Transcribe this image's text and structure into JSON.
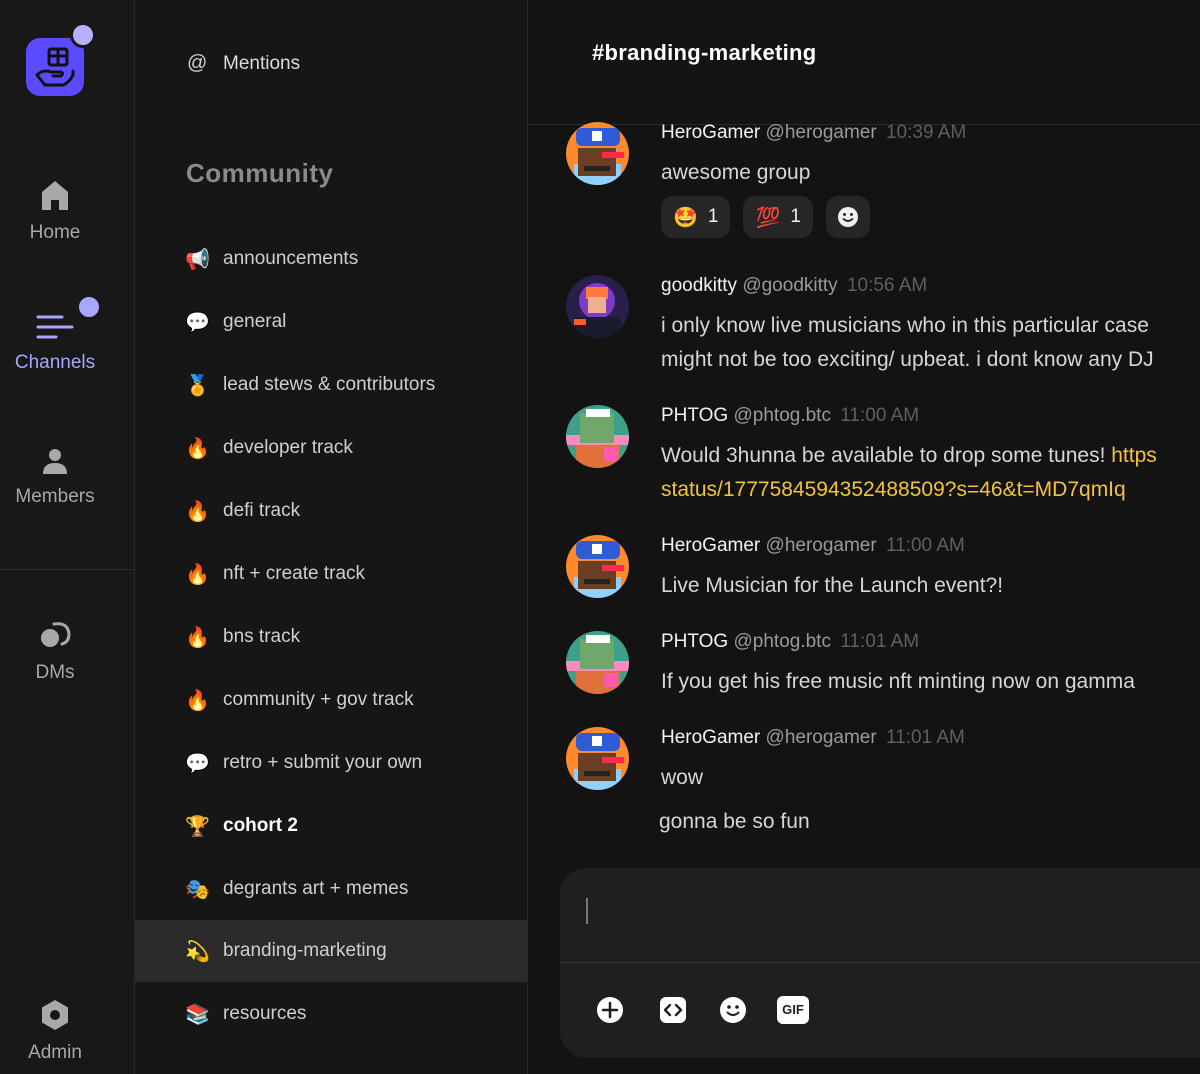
{
  "rail": {
    "home_label": "Home",
    "channels_label": "Channels",
    "members_label": "Members",
    "dms_label": "DMs",
    "admin_label": "Admin"
  },
  "sidebar": {
    "mentions_label": "Mentions",
    "section_title": "Community",
    "channels": [
      {
        "emoji": "📢",
        "name": "announcements"
      },
      {
        "emoji": "💬",
        "name": "general"
      },
      {
        "emoji": "🏅",
        "name": "lead stews & contributors"
      },
      {
        "emoji": "🔥",
        "name": "developer track"
      },
      {
        "emoji": "🔥",
        "name": "defi track"
      },
      {
        "emoji": "🔥",
        "name": "nft + create track"
      },
      {
        "emoji": "🔥",
        "name": "bns track"
      },
      {
        "emoji": "🔥",
        "name": "community + gov track"
      },
      {
        "emoji": "💬",
        "name": "retro + submit your own"
      },
      {
        "emoji": "🏆",
        "name": "cohort 2"
      },
      {
        "emoji": "🎭",
        "name": "degrants art + memes"
      },
      {
        "emoji": "💫",
        "name": "branding-marketing"
      },
      {
        "emoji": "📚",
        "name": "resources"
      }
    ]
  },
  "channel": {
    "title": "#branding-marketing"
  },
  "messages": [
    {
      "name": "HeroGamer",
      "handle": "@herogamer",
      "time": "10:39 AM",
      "lines": [
        "awesome group"
      ]
    },
    {
      "name": "goodkitty",
      "handle": "@goodkitty",
      "time": "10:56 AM",
      "lines": [
        "i only know live musicians who in this particular case",
        "might not be too exciting/ upbeat. i dont know any DJ"
      ]
    },
    {
      "name": "PHTOG",
      "handle": "@phtog.btc",
      "time": "11:00 AM",
      "line1": "Would 3hunna be available to drop some tunes! ",
      "link1": "https",
      "link2": "status/1777584594352488509?s=46&t=MD7qmIq"
    },
    {
      "name": "HeroGamer",
      "handle": "@herogamer",
      "time": "11:00 AM",
      "lines": [
        "Live Musician for the Launch event?!"
      ]
    },
    {
      "name": "PHTOG",
      "handle": "@phtog.btc",
      "time": "11:01 AM",
      "lines": [
        "If you get his free music nft minting now on gamma"
      ]
    },
    {
      "name": "HeroGamer",
      "handle": "@herogamer",
      "time": "11:01 AM",
      "lines": [
        "wow"
      ],
      "followup": "gonna be so fun"
    }
  ],
  "reactions": [
    {
      "emoji": "🤩",
      "count": "1"
    },
    {
      "emoji": "💯",
      "count": "1"
    }
  ],
  "composer": {
    "tools": [
      "add-icon",
      "code-icon",
      "emoji-icon",
      "gif-icon"
    ],
    "gif_label": "GIF"
  },
  "colors": {
    "accent": "#a8a6ff",
    "logo": "#5b4bff",
    "link": "#f3c33b"
  }
}
